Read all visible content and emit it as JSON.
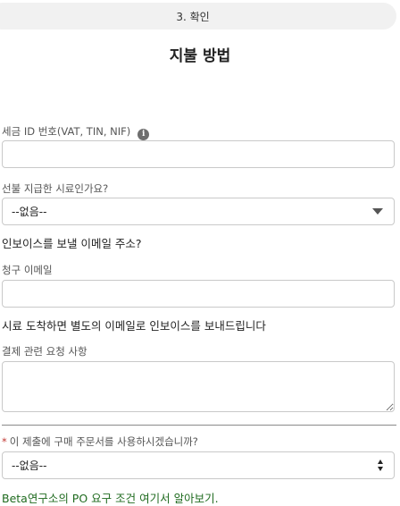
{
  "step": {
    "label": "3. 확인"
  },
  "page": {
    "title": "지불 방법"
  },
  "tax_id": {
    "label": "세금 ID 번호(VAT, TIN, NIF)",
    "info_icon": "info-icon",
    "value": ""
  },
  "prepaid": {
    "label": "선불 지급한 시료인가요?",
    "selected": "--없음--",
    "icon": "chevron-down-icon"
  },
  "invoice_email": {
    "heading": "인보이스를 보낼 이메일 주소?",
    "label": "청구 이메일",
    "value": ""
  },
  "notice": {
    "text": "시료 도착하면 별도의 이메일로 인보이스를 보내드립니다"
  },
  "payment_request": {
    "label": "결제 관련 요청 사항",
    "value": ""
  },
  "purchase_order": {
    "required_mark": "*",
    "label": "이 제출에 구매 주문서를 사용하시겠습니까?",
    "selected": "--없음--",
    "icon": "updown-icon"
  },
  "help": {
    "link_text": "Beta연구소의 PO 요구 조건 여기서 알아보기."
  },
  "colors": {
    "link": "#1f6b1f",
    "required": "#c23934",
    "border": "#c9c9c9",
    "pill_background": "#f1f1f1"
  }
}
